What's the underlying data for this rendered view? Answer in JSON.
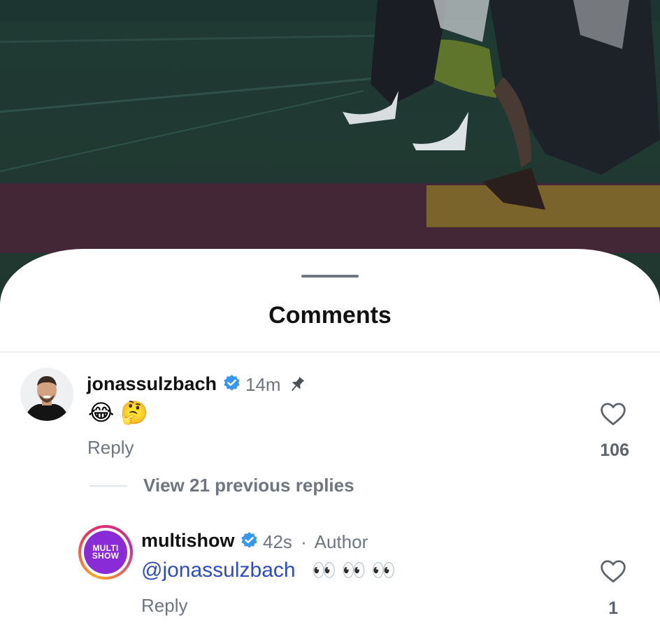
{
  "sheet": {
    "title": "Comments"
  },
  "comments": [
    {
      "username": "jonassulzbach",
      "verified": true,
      "time": "14m",
      "pinned": true,
      "text": "😂 🤔",
      "reply_label": "Reply",
      "likes": "106",
      "avatar": "profile-photo"
    }
  ],
  "view_replies": {
    "label": "View 21 previous replies"
  },
  "replies": [
    {
      "username": "multishow",
      "verified": true,
      "time": "42s",
      "separator": "·",
      "tag": "Author",
      "mention": "@jonassulzbach",
      "emojis": "👀 👀 👀",
      "reply_label": "Reply",
      "likes": "1",
      "avatar_text": "MULTI SHOW"
    }
  ],
  "colors": {
    "verified_badge": "#3897f0",
    "mention": "#2e4bc0",
    "muted_text": "#6e7681",
    "multishow_purple": "#8a2bd8",
    "multishow_ring": "#e8305f"
  }
}
